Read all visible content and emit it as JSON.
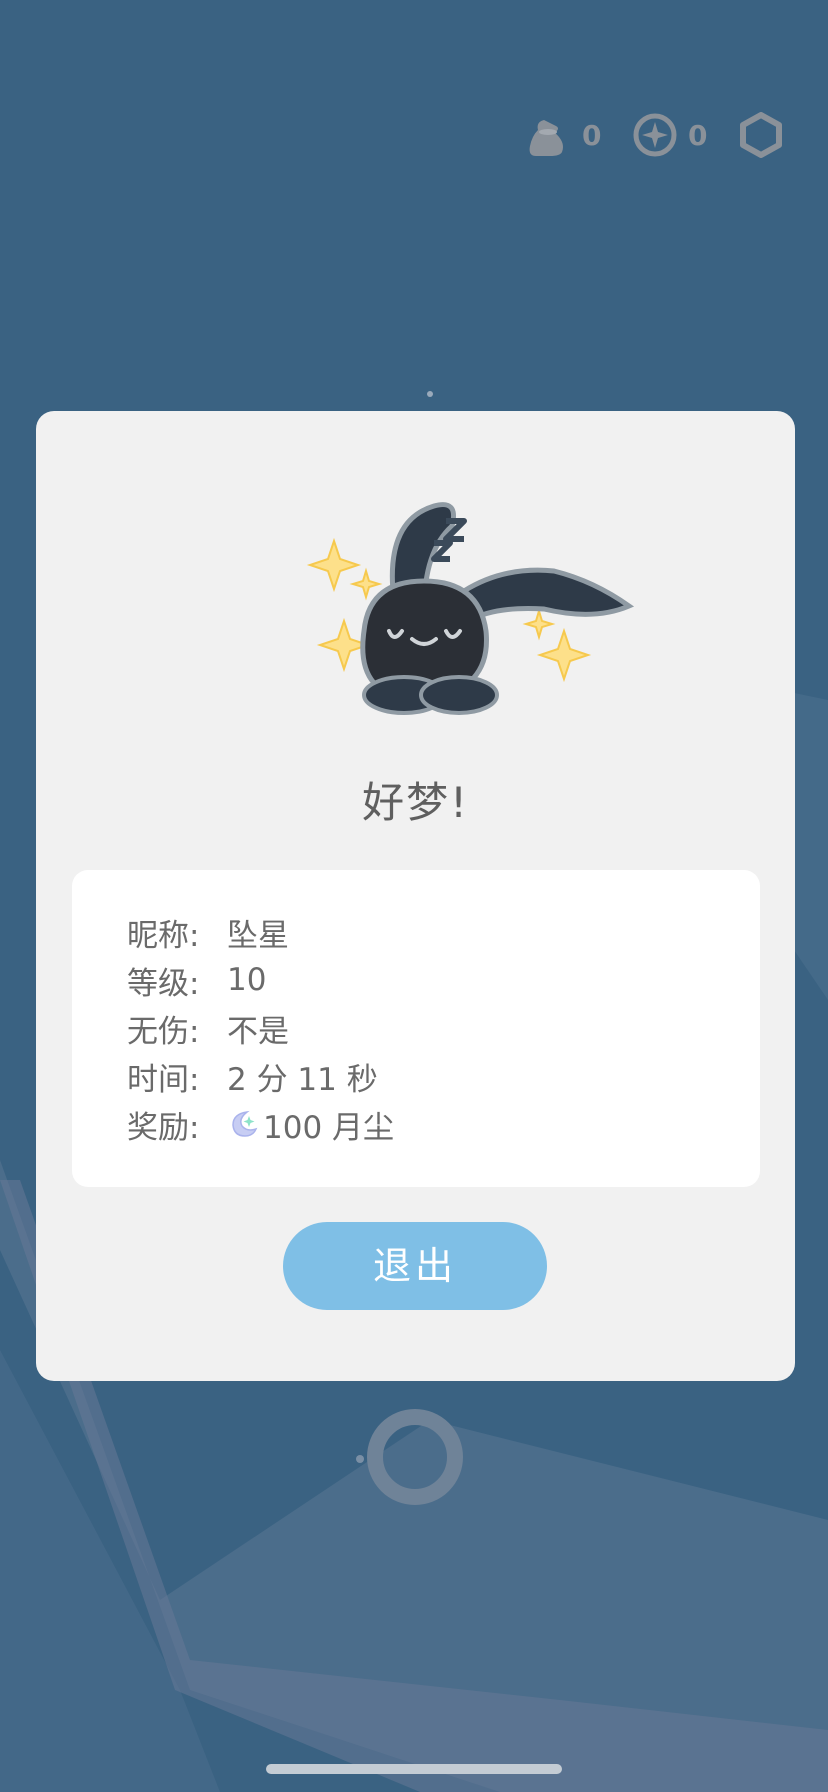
{
  "hud": {
    "bag_count": "0",
    "compass_count": "0",
    "settings_icon": "hexagon-settings-icon"
  },
  "dialog": {
    "title": "好梦!",
    "rows": [
      {
        "label": "昵称:",
        "value": "坠星"
      },
      {
        "label": "等级:",
        "value": "10"
      },
      {
        "label": "无伤:",
        "value": "不是"
      },
      {
        "label": "时间:",
        "value": "2 分 11 秒"
      },
      {
        "label": "奖励:",
        "value": "100 月尘",
        "icon": "moon-dust-icon"
      }
    ],
    "exit_label": "退出"
  },
  "colors": {
    "background": "#3a6282",
    "dialog": "#f1f1f1",
    "card": "#ffffff",
    "button": "#7fbfe6",
    "text": "#6a6a6a"
  }
}
